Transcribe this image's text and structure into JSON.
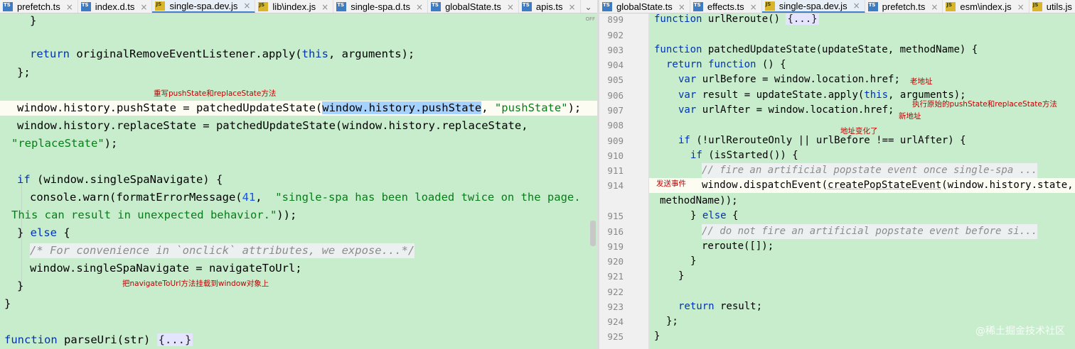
{
  "left_tabs": [
    {
      "name": "prefetch.ts",
      "icon": "ts-file-icon",
      "badge": "TS",
      "active": false
    },
    {
      "name": "index.d.ts",
      "icon": "ts-file-icon",
      "badge": "TS",
      "active": false
    },
    {
      "name": "single-spa.dev.js",
      "icon": "js-file-icon",
      "badge": "JS",
      "active": true
    },
    {
      "name": "lib\\index.js",
      "icon": "js-file-icon",
      "badge": "JS",
      "active": false
    },
    {
      "name": "single-spa.d.ts",
      "icon": "ts-file-icon",
      "badge": "TS",
      "active": false
    },
    {
      "name": "globalState.ts",
      "icon": "ts-file-icon",
      "badge": "TS",
      "active": false
    },
    {
      "name": "apis.ts",
      "icon": "ts-file-icon",
      "badge": "TS",
      "active": false
    }
  ],
  "right_tabs": [
    {
      "name": "globalState.ts",
      "icon": "ts-file-icon",
      "badge": "TS",
      "active": false
    },
    {
      "name": "effects.ts",
      "icon": "ts-file-icon",
      "badge": "TS",
      "active": false
    },
    {
      "name": "single-spa.dev.js",
      "icon": "js-file-icon",
      "badge": "JS",
      "active": true
    },
    {
      "name": "prefetch.ts",
      "icon": "ts-file-icon",
      "badge": "TS",
      "active": false
    },
    {
      "name": "esm\\index.js",
      "icon": "js-file-icon",
      "badge": "JS",
      "active": false
    },
    {
      "name": "utils.js",
      "icon": "js-file-icon",
      "badge": "JS",
      "active": false
    }
  ],
  "tab_close_glyph": "×",
  "chevron_glyph": "⌄",
  "off_label": "OFF",
  "left_code": {
    "l1": "}",
    "l2_kw": "return",
    "l2_rest": " originalRemoveEventListener.apply(",
    "l2_this": "this",
    "l2_end": ", arguments);",
    "l3": "};",
    "l4_a": "window.history.pushState = patchedUpdateState(",
    "l4_sel": "window.history.pushState",
    "l4_b": ", ",
    "l4_str": "\"pushState\"",
    "l4_c": ");",
    "l5": "window.history.replaceState = patchedUpdateState(window.history.replaceState,",
    "l6_str": "\"replaceState\"",
    "l6_c": ");",
    "l7_kw": "if",
    "l7_rest": " (window.singleSpaNavigate) {",
    "l8_a": "console.warn(formatErrorMessage(",
    "l8_num": "41",
    "l8_b": ",  ",
    "l8_str": "\"single-spa has been loaded twice on the page.",
    "l9_str": "This can result in unexpected behavior.\"",
    "l9_c": "));",
    "l10_a": "} ",
    "l10_kw": "else",
    "l10_b": " {",
    "l11_com": "/* For convenience in `onclick` attributes, we expose...*/",
    "l12": "window.singleSpaNavigate = navigateToUrl;",
    "l13": "}",
    "l14": "}",
    "l15_kw": "function",
    "l15_rest": " parseUri(str) ",
    "l15_fold": "{...}"
  },
  "right_code": [
    {
      "ln": "899"
    },
    {
      "ln": "902"
    },
    {
      "ln": "903"
    },
    {
      "ln": "904"
    },
    {
      "ln": "905"
    },
    {
      "ln": "906"
    },
    {
      "ln": "907"
    },
    {
      "ln": "908"
    },
    {
      "ln": "909"
    },
    {
      "ln": "910"
    },
    {
      "ln": "911"
    },
    {
      "ln": "914"
    },
    {
      "ln": ""
    },
    {
      "ln": "915"
    },
    {
      "ln": "916"
    },
    {
      "ln": "919"
    },
    {
      "ln": "920"
    },
    {
      "ln": "921"
    },
    {
      "ln": "922"
    },
    {
      "ln": "923"
    },
    {
      "ln": "924"
    },
    {
      "ln": "925"
    }
  ],
  "rc": {
    "r1_kw": "function",
    "r1_rest": " urlReroute() ",
    "r1_fold": "{...}",
    "r3_kw": "function",
    "r3_rest": " patchedUpdateState(updateState, methodName) {",
    "r4_kw": "return",
    "r4_kw2": "function",
    "r4_rest": " () {",
    "r5_kw": "var",
    "r5_rest": " urlBefore = window.location.href;",
    "r6_kw": "var",
    "r6_rest": " result = updateState.apply(",
    "r6_this": "this",
    "r6_end": ", arguments);",
    "r7_kw": "var",
    "r7_rest": " urlAfter = window.location.href;",
    "r9_kw": "if",
    "r9_rest": " (!urlRerouteOnly || urlBefore !== urlAfter) {",
    "r10_kw": "if",
    "r10_rest": " (isStarted()) {",
    "r11_com": "// fire an artificial popstate event once single-spa ...",
    "r12_a": "window.dispatchEvent(",
    "r12_ul": "createPopStateEvent",
    "r12_b": "(window.history.state,",
    "r13": "methodName));",
    "r14_a": "} ",
    "r14_kw": "else",
    "r14_b": " {",
    "r15_com": "// do not fire an artificial popstate event before si...",
    "r16": "reroute([]);",
    "r17": "}",
    "r18": "}",
    "r20_kw": "return",
    "r20_rest": " result;",
    "r21": "};",
    "r22": "}"
  },
  "notes": {
    "rewrite": "重写pushState和replaceState方法",
    "mount": "把navigateToUrl方法挂载到window对象上",
    "old_url": "老地址",
    "call_original": "执行原始的pushState和replaceState方法",
    "new_url": "新地址",
    "url_changed": "地址变化了",
    "dispatch": "发送事件"
  },
  "watermark": "@稀土掘金技术社区"
}
